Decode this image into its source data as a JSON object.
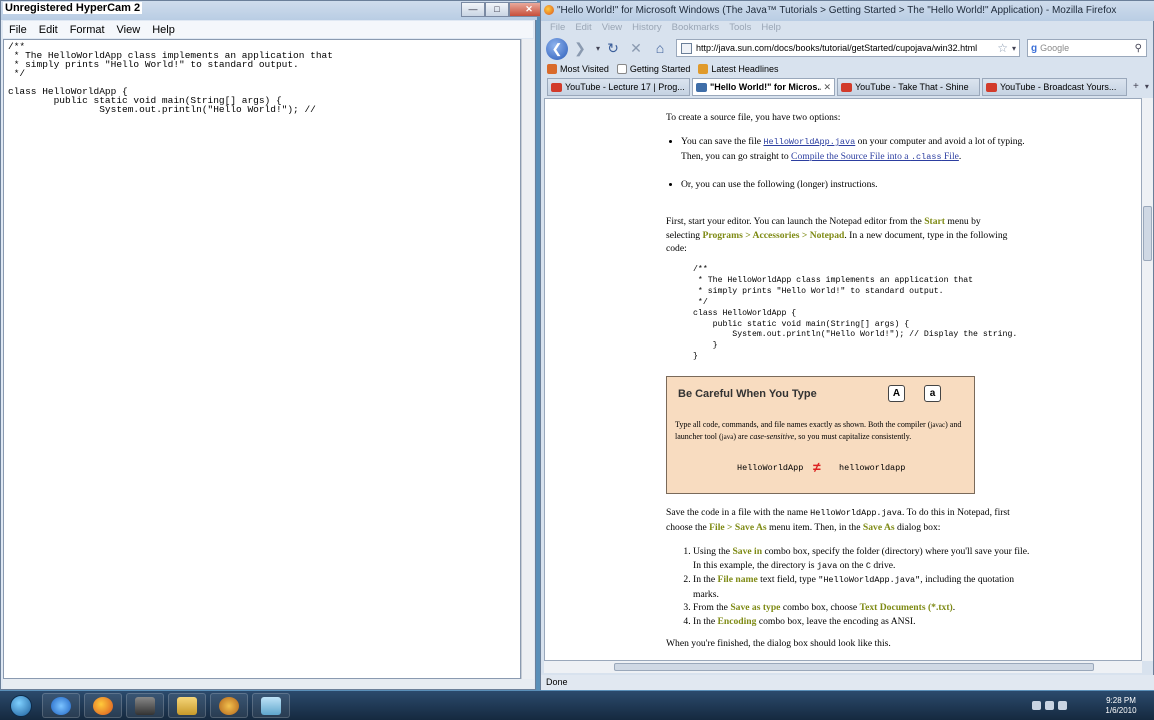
{
  "notepad": {
    "title": "Unregistered HyperCam 2",
    "menu": [
      "File",
      "Edit",
      "Format",
      "View",
      "Help"
    ],
    "content": "/**\n * The HelloWorldApp class implements an application that\n * simply prints \"Hello World!\" to standard output.\n */\n\nclass HelloWorldApp {\n        public static void main(String[] args) {\n                System.out.println(\"Hello World!\"); //"
  },
  "firefox": {
    "title": "\"Hello World!\" for Microsoft Windows (The Java™ Tutorials > Getting Started > The \"Hello World!\" Application) - Mozilla Firefox",
    "menu": [
      "File",
      "Edit",
      "View",
      "History",
      "Bookmarks",
      "Tools",
      "Help"
    ],
    "url": "http://java.sun.com/docs/books/tutorial/getStarted/cupojava/win32.html",
    "search_placeholder": "Google",
    "bookmarks": [
      "Most Visited",
      "Getting Started",
      "Latest Headlines"
    ],
    "tabs": [
      {
        "label": "YouTube - Lecture 17 | Prog..."
      },
      {
        "label": "\"Hello World!\" for Micros..."
      },
      {
        "label": "YouTube - Take That - Shine"
      },
      {
        "label": "YouTube - Broadcast Yours..."
      }
    ],
    "status": "Done"
  },
  "page": {
    "intro": "To create a source file, you have two options:",
    "bullet1": {
      "pre": "You can save the file ",
      "file_link": "HelloWorldApp.java",
      "mid": " on your computer and avoid a lot of typing. Then, you can go straight to ",
      "compile_link": "Compile the Source File into a ",
      "compile_code": ".class",
      "compile_tail": " File",
      "end": "."
    },
    "bullet2": "Or, you can use the following (longer) instructions.",
    "first": {
      "a": "First, start your editor. You can launch the Notepad editor from the ",
      "start": "Start",
      "b": " menu by selecting ",
      "path": "Programs > Accessories > Notepad",
      "c": ". In a new document, type in the following code:"
    },
    "code": "/**\n * The HelloWorldApp class implements an application that\n * simply prints \"Hello World!\" to standard output.\n */\nclass HelloWorldApp {\n    public static void main(String[] args) {\n        System.out.println(\"Hello World!\"); // Display the string.\n    }\n}",
    "careful": {
      "title": "Be Careful When You Type",
      "key_upper": "A",
      "key_lower": "a",
      "t1": "Type all code, commands, and file names exactly as shown. Both the compiler (",
      "c1": "javac",
      "t2": ") and launcher tool (",
      "c2": "java",
      "t3": ") are ",
      "em": "case-sensitive",
      "t4": ", so you must capitalize consistently.",
      "left": "HelloWorldApp",
      "right": "helloworldapp"
    },
    "save": {
      "a": "Save the code in a file with the name ",
      "file": "HelloWorldApp.java",
      "b": ". To do this in Notepad, first choose the ",
      "menu": "File > Save As",
      "c": " menu item. Then, in the ",
      "dialog": "Save As",
      "d": " dialog box:"
    },
    "steps": [
      {
        "a": "Using the ",
        "k": "Save in",
        "b": " combo box, specify the folder (directory) where you'll save your file. In this example, the directory is ",
        "c1": "java",
        "b2": " on the ",
        "c2": "C",
        "e": " drive."
      },
      {
        "a": "In the ",
        "k": "File name",
        "b": " text field, type ",
        "c1": "\"HelloWorldApp.java\"",
        "e": ", including the quotation marks."
      },
      {
        "a": "From the ",
        "k": "Save as type",
        "b": " combo box, choose ",
        "k2": "Text Documents (*.txt)",
        "e": "."
      },
      {
        "a": "In the ",
        "k": "Encoding",
        "b": " combo box, leave the encoding as ANSI."
      }
    ],
    "finished": "When you're finished, the dialog box should look like this."
  },
  "taskbar": {
    "clock_time": "9:28 PM",
    "clock_date": "1/6/2010"
  }
}
